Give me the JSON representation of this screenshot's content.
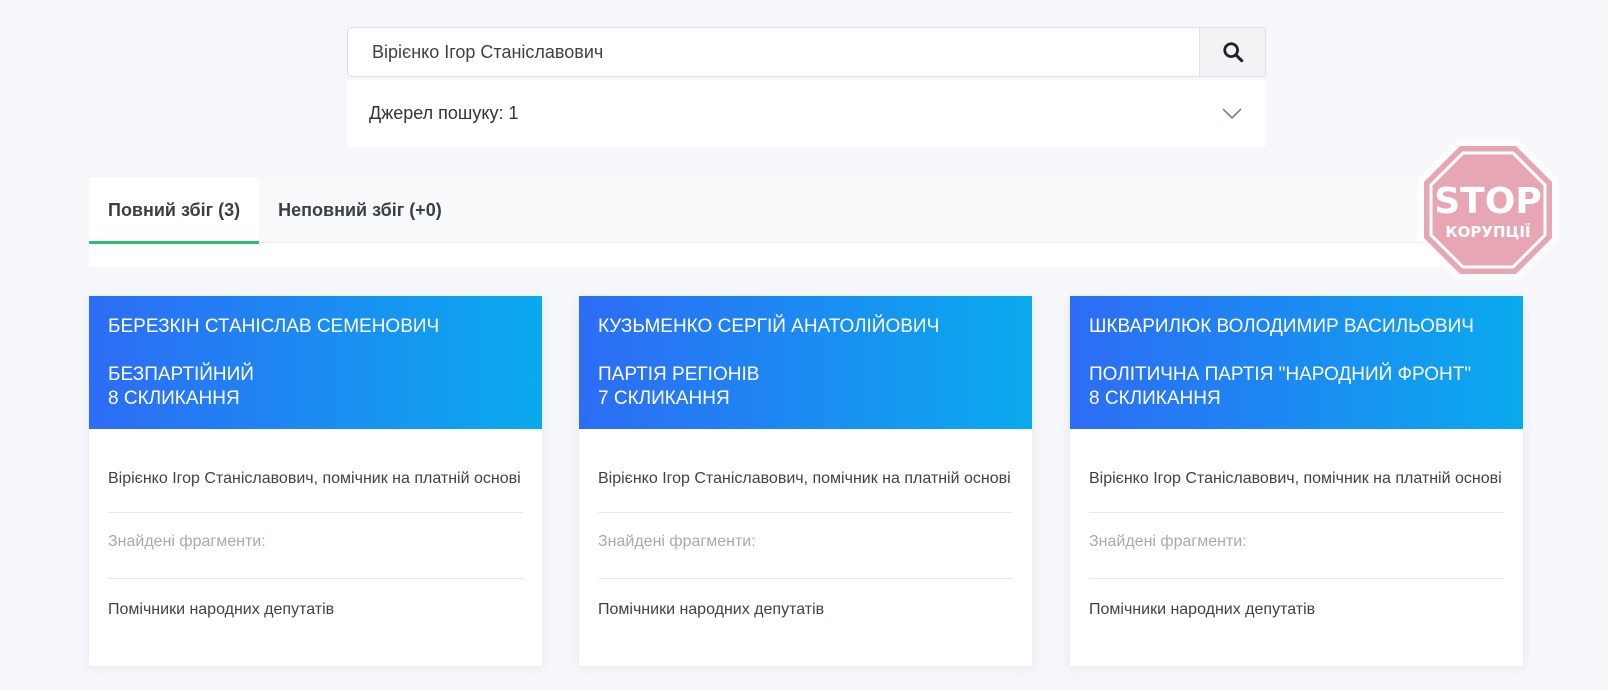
{
  "search": {
    "value": "Вірієнко Ігор Станіславович",
    "button_icon": "search-icon"
  },
  "sources": {
    "label": "Джерел пошуку: 1",
    "icon": "chevron-down-icon"
  },
  "tabs": [
    {
      "label": "Повний збіг (3)",
      "active": true
    },
    {
      "label": "Неповний збіг (+0)",
      "active": false
    }
  ],
  "logo": {
    "text_top": "STOP",
    "text_bottom": "КОРУПЦІЇ",
    "color": "#e6a6b4"
  },
  "colors": {
    "header_gradient_start": "#2d6cf5",
    "header_gradient_end": "#0aaaee",
    "active_tab_accent": "#2fbf71"
  },
  "cards": [
    {
      "name": "БЕРЕЗКІН СТАНІСЛАВ СЕМЕНОВИЧ",
      "party": "БЕЗПАРТІЙНИЙ",
      "convocation": "8 СКЛИКАННЯ",
      "assistant": "Вірієнко Ігор Станіславович, помічник на платній основі",
      "fragments_label": "Знайдені фрагменти:",
      "source": "Помічники народних депутатів"
    },
    {
      "name": "КУЗЬМЕНКО СЕРГІЙ АНАТОЛІЙОВИЧ",
      "party": "ПАРТІЯ РЕГІОНІВ",
      "convocation": "7 СКЛИКАННЯ",
      "assistant": "Вірієнко Ігор Станіславович, помічник на платній основі",
      "fragments_label": "Знайдені фрагменти:",
      "source": "Помічники народних депутатів"
    },
    {
      "name": "ШКВАРИЛЮК ВОЛОДИМИР ВАСИЛЬОВИЧ",
      "party": "ПОЛІТИЧНА ПАРТІЯ \"НАРОДНИЙ ФРОНТ\"",
      "convocation": "8 СКЛИКАННЯ",
      "assistant": "Вірієнко Ігор Станіславович, помічник на платній основі",
      "fragments_label": "Знайдені фрагменти:",
      "source": "Помічники народних депутатів"
    }
  ]
}
